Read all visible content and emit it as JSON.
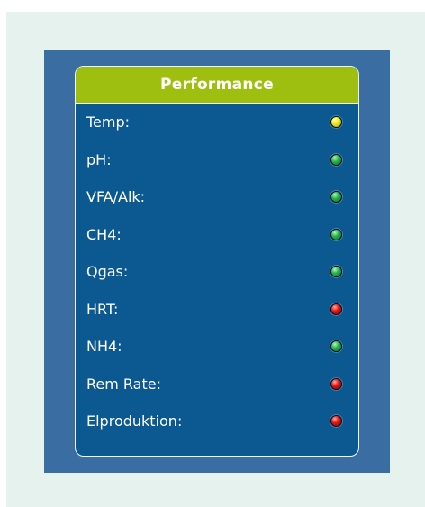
{
  "card": {
    "title": "Performance"
  },
  "status_colors": {
    "yellow": "#f2ef2a",
    "green": "#23b54f",
    "red": "#e51616"
  },
  "indicators": [
    {
      "label": "Temp:",
      "status": "yellow",
      "icon": "status-led-icon"
    },
    {
      "label": "pH:",
      "status": "green",
      "icon": "status-led-icon"
    },
    {
      "label": "VFA/Alk:",
      "status": "green",
      "icon": "status-led-icon"
    },
    {
      "label": "CH4:",
      "status": "green",
      "icon": "status-led-icon"
    },
    {
      "label": "Qgas:",
      "status": "green",
      "icon": "status-led-icon"
    },
    {
      "label": "HRT:",
      "status": "red",
      "icon": "status-led-icon"
    },
    {
      "label": "NH4:",
      "status": "green",
      "icon": "status-led-icon"
    },
    {
      "label": "Rem Rate:",
      "status": "red",
      "icon": "status-led-icon"
    },
    {
      "label": "Elproduktion:",
      "status": "red",
      "icon": "status-led-icon"
    }
  ]
}
